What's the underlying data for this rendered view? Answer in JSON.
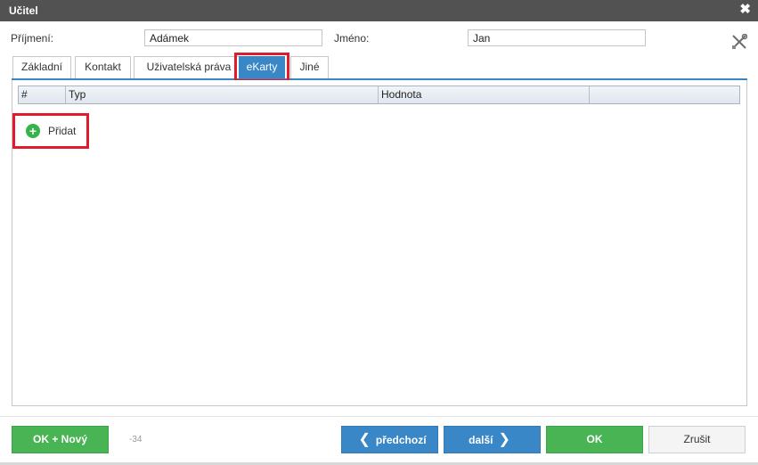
{
  "window": {
    "title": "Učitel"
  },
  "form": {
    "surname_label": "Příjmení:",
    "surname_value": "Adámek",
    "name_label": "Jméno:",
    "name_value": "Jan"
  },
  "tabs": [
    {
      "label": "Základní"
    },
    {
      "label": "Kontakt"
    },
    {
      "label": "Uživatelská práva"
    },
    {
      "label": "eKarty",
      "active": true
    },
    {
      "label": "Jiné"
    }
  ],
  "grid": {
    "columns": [
      "#",
      "Typ",
      "Hodnota",
      ""
    ]
  },
  "actions": {
    "add_label": "Přidat"
  },
  "footer": {
    "ok_new_label": "OK + Nový",
    "record_number": "-34",
    "prev_label": "předchozí",
    "next_label": "další",
    "ok_label": "OK",
    "cancel_label": "Zrušit"
  },
  "colors": {
    "accent": "#3a87c8",
    "primary_green": "#48b454",
    "highlight_red": "#e01b2d",
    "titlebar": "#525252"
  },
  "icons": {
    "close": "close-icon",
    "tools": "tools-icon",
    "add": "plus-circle-icon",
    "prev": "chevron-left-icon",
    "next": "chevron-right-icon"
  }
}
